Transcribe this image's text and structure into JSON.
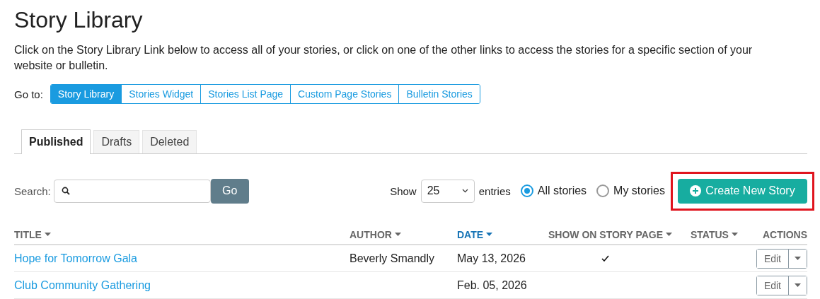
{
  "page": {
    "title": "Story Library",
    "intro": "Click on the Story Library Link below to access all of your stories, or click on one of the other links to access the stories for a specific section of your website or bulletin."
  },
  "goto": {
    "label": "Go to:",
    "links": [
      {
        "label": "Story Library",
        "selected": true
      },
      {
        "label": "Stories Widget",
        "selected": false
      },
      {
        "label": "Stories List Page",
        "selected": false
      },
      {
        "label": "Custom Page Stories",
        "selected": false
      },
      {
        "label": "Bulletin Stories",
        "selected": false
      }
    ]
  },
  "tabs": [
    {
      "label": "Published",
      "selected": true
    },
    {
      "label": "Drafts",
      "selected": false
    },
    {
      "label": "Deleted",
      "selected": false
    }
  ],
  "toolbar": {
    "search_label": "Search:",
    "go_button": "Go",
    "show_label": "Show",
    "entries_value": "25",
    "entries_label": "entries",
    "filters": [
      {
        "label": "All stories",
        "selected": true
      },
      {
        "label": "My stories",
        "selected": false
      }
    ],
    "create_button": {
      "label": "Create New Story",
      "highlighted": true
    }
  },
  "table": {
    "columns": [
      {
        "label": "TITLE",
        "sortable": true,
        "sorted": false
      },
      {
        "label": "AUTHOR",
        "sortable": true,
        "sorted": false
      },
      {
        "label": "DATE",
        "sortable": true,
        "sorted": true
      },
      {
        "label": "SHOW ON STORY PAGE",
        "sortable": true,
        "sorted": false
      },
      {
        "label": "STATUS",
        "sortable": true,
        "sorted": false
      },
      {
        "label": "ACTIONS",
        "sortable": false,
        "sorted": false
      }
    ],
    "rows": [
      {
        "title": "Hope for Tomorrow Gala",
        "author": "Beverly Smandly",
        "date": "May 13, 2026",
        "show_on_story_page": true,
        "edit_button": "Edit"
      },
      {
        "title": "Club Community Gathering",
        "date": "Feb. 05, 2026",
        "edit_button": "Edit"
      }
    ]
  }
}
